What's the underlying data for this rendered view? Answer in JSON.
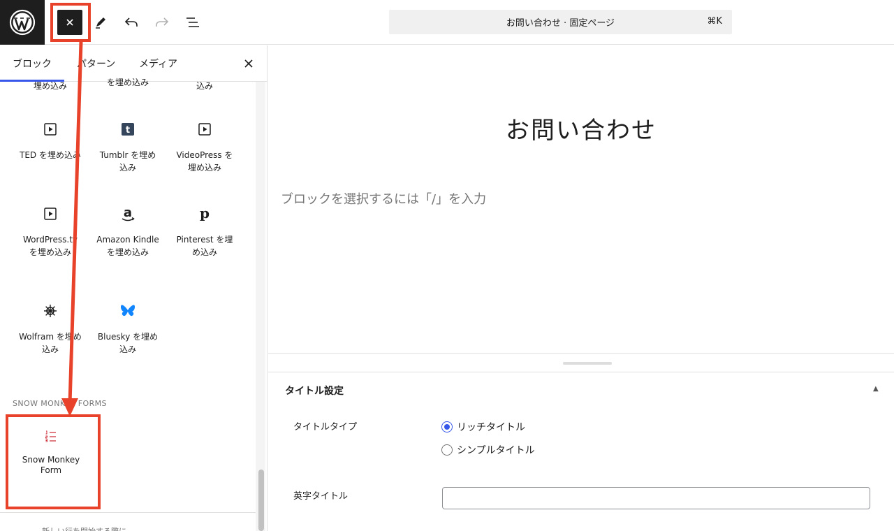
{
  "colors": {
    "accent": "#3858e9",
    "annotation": "#e8432a",
    "bluesky": "#1185fe",
    "snow_monkey": "#cd2e3a"
  },
  "toolbar": {
    "logo_icon": "wordpress-logo-icon",
    "close_icon": "close-icon",
    "tools_icon": "pen-icon",
    "undo_icon": "undo-icon",
    "redo_icon": "redo-icon",
    "outline_icon": "document-outline-icon",
    "command_bar": {
      "title": "お問い合わせ · 固定ページ",
      "shortcut": "⌘K"
    }
  },
  "inserter": {
    "tabs": [
      {
        "label": "ブロック"
      },
      {
        "label": "パターン"
      },
      {
        "label": "メディア"
      }
    ],
    "cut_labels": [
      "埋め込み",
      "を埋め込み",
      "込み"
    ],
    "blocks": [
      {
        "label": "TED を埋め込み",
        "icon": "embed-video-icon"
      },
      {
        "label": "Tumblr を埋め込み",
        "icon": "tumblr-icon"
      },
      {
        "label": "VideoPress を埋め込み",
        "icon": "embed-video-icon"
      },
      {
        "label": "WordPress.tv を埋め込み",
        "icon": "embed-video-icon"
      },
      {
        "label": "Amazon Kindle を埋め込み",
        "icon": "amazon-icon"
      },
      {
        "label": "Pinterest を埋め込み",
        "icon": "pinterest-icon"
      },
      {
        "label": "Wolfram を埋め込み",
        "icon": "wolfram-icon"
      },
      {
        "label": "Bluesky を埋め込み",
        "icon": "bluesky-icon"
      }
    ],
    "category_title": "SNOW MONKEY FORMS",
    "snow_monkey_form": {
      "label": "Snow Monkey Form",
      "icon": "form-list-icon"
    },
    "bottom_text": "新しい行を開始する際に"
  },
  "editor": {
    "title": "お問い合わせ",
    "placeholder": "ブロックを選択するには「/」を入力"
  },
  "meta_box": {
    "title": "タイトル設定",
    "title_type_label": "タイトルタイプ",
    "options": [
      {
        "label": "リッチタイトル",
        "checked": true
      },
      {
        "label": "シンプルタイトル",
        "checked": false
      }
    ],
    "english_title_label": "英字タイトル",
    "english_title_value": ""
  }
}
